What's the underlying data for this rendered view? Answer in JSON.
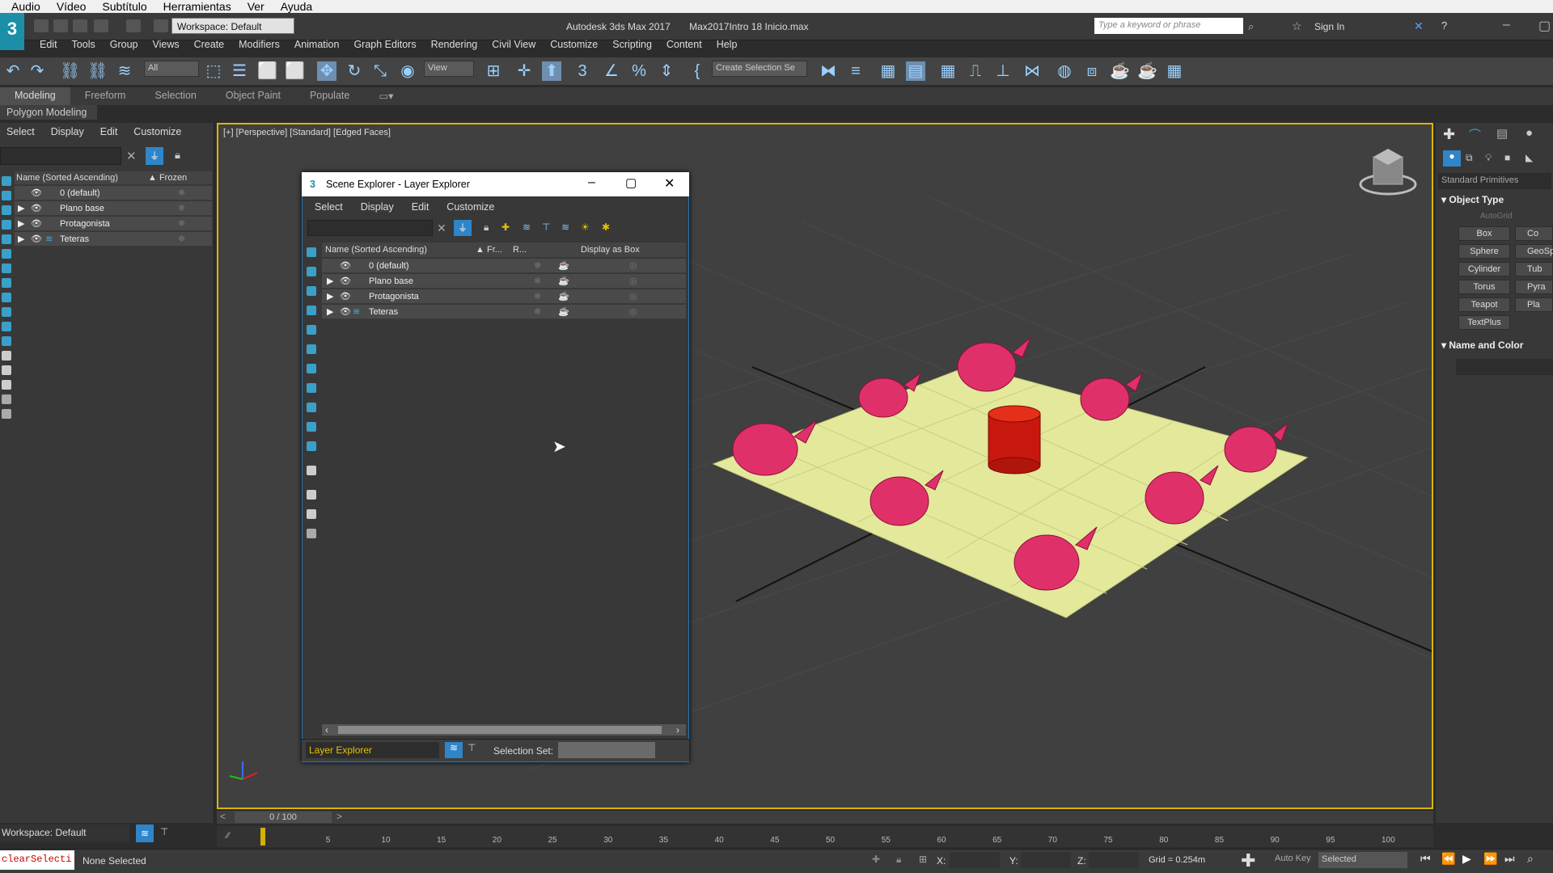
{
  "player_menu": [
    "Audio",
    "Vídeo",
    "Subtítulo",
    "Herramientas",
    "Ver",
    "Ayuda"
  ],
  "titlebar": {
    "workspace": "Workspace: Default",
    "app_title": "Autodesk 3ds Max 2017",
    "file_title": "Max2017Intro 18 Inicio.max",
    "search_placeholder": "Type a keyword or phrase",
    "sign_in": "Sign In"
  },
  "main_menu": [
    "Edit",
    "Tools",
    "Group",
    "Views",
    "Create",
    "Modifiers",
    "Animation",
    "Graph Editors",
    "Rendering",
    "Civil View",
    "Customize",
    "Scripting",
    "Content",
    "Help"
  ],
  "toolbar": {
    "filter_dd": "All",
    "view_dd": "View",
    "create_selection": "Create Selection Se"
  },
  "ribbon": {
    "tabs": [
      "Modeling",
      "Freeform",
      "Selection",
      "Object Paint",
      "Populate"
    ],
    "sub": "Polygon Modeling"
  },
  "left_explorer": {
    "menu": [
      "Select",
      "Display",
      "Edit",
      "Customize"
    ],
    "col_name": "Name (Sorted Ascending)",
    "col_frozen": "▲ Frozen",
    "rows": [
      "0 (default)",
      "Plano base",
      "Protagonista",
      "Teteras"
    ],
    "workspace": "Workspace: Default"
  },
  "viewport": {
    "label": "[+] [Perspective] [Standard] [Edged Faces]"
  },
  "layer_explorer": {
    "title": "Scene Explorer - Layer Explorer",
    "menu": [
      "Select",
      "Display",
      "Edit",
      "Customize"
    ],
    "col_name": "Name (Sorted Ascending)",
    "col_fr": "Fr...",
    "col_r": "R...",
    "col_box": "Display as Box",
    "rows": [
      "0 (default)",
      "Plano base",
      "Protagonista",
      "Teteras"
    ],
    "footer_dd": "Layer Explorer",
    "selection_set": "Selection Set:"
  },
  "command_panel": {
    "category": "Standard Primitives",
    "object_type": "Object Type",
    "autogrid": "AutoGrid",
    "buttons": [
      "Box",
      "Cone",
      "Sphere",
      "GeoSphere",
      "Cylinder",
      "Tube",
      "Torus",
      "Pyramid",
      "Teapot",
      "Plane",
      "TextPlus"
    ],
    "buttons_visible": [
      "Box",
      "Co",
      "Sphere",
      "GeoSp",
      "Cylinder",
      "Tub",
      "Torus",
      "Pyra",
      "Teapot",
      "Pla",
      "TextPlus"
    ],
    "name_color": "Name and Color"
  },
  "timeline": {
    "frame": "0 / 100",
    "ticks": [
      "5",
      "10",
      "15",
      "20",
      "25",
      "30",
      "35",
      "40",
      "45",
      "50",
      "55",
      "60",
      "65",
      "70",
      "75",
      "80",
      "85",
      "90",
      "95",
      "100"
    ]
  },
  "status": {
    "maxscript": "clearSelecti",
    "selection": "None Selected",
    "x_label": "X:",
    "y_label": "Y:",
    "z_label": "Z:",
    "grid": "Grid = 0.254m",
    "auto_key": "Auto Key",
    "selected_dd": "Selected"
  },
  "colors": {
    "accent_blue": "#1f7ac0",
    "viewport_border": "#d8b800",
    "teapot": "#e0306a",
    "ground": "#e4e89a",
    "cylinder": "#d01a10"
  }
}
